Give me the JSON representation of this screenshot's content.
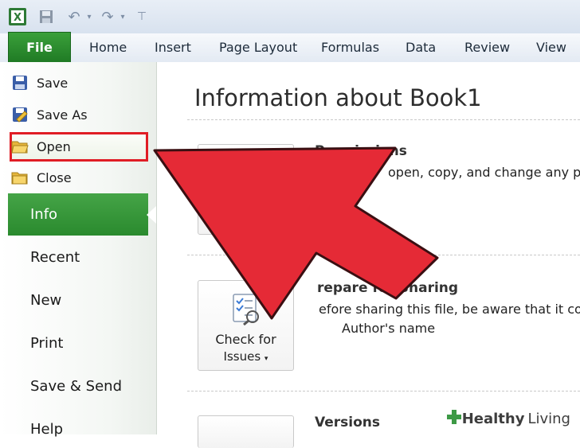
{
  "ribbon": {
    "file_tab": "File",
    "tabs": [
      "Home",
      "Insert",
      "Page Layout",
      "Formulas",
      "Data",
      "Review",
      "View"
    ]
  },
  "backstage": {
    "commands": [
      "Save",
      "Save As",
      "Open",
      "Close"
    ],
    "nav": [
      "Info",
      "Recent",
      "New",
      "Print",
      "Save & Send",
      "Help"
    ]
  },
  "info": {
    "title": "Information about Book1",
    "permissions_title": "Permissions",
    "permissions_text": "open, copy, and change any pa",
    "prepare_title": "repare for Sharing",
    "prepare_text": "efore sharing this file, be aware that it con",
    "prepare_item": "Author's name",
    "check_issues_line1": "Check for",
    "check_issues_line2": "Issues",
    "versions_title": "Versions"
  },
  "watermark": {
    "brand1": "Healthy",
    "brand2": "Living"
  },
  "colors": {
    "file_green": "#2a8a2e",
    "highlight_red": "#e01d25",
    "arrow_red": "#e52a36"
  }
}
